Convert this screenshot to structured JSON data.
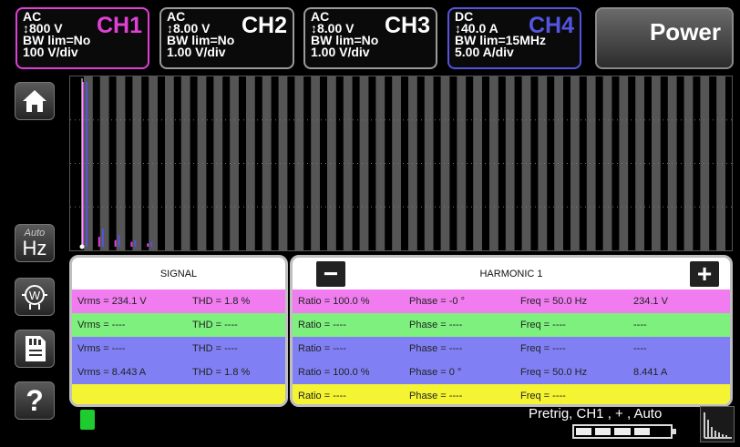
{
  "channels": [
    {
      "id": "ch1",
      "coupling": "AC",
      "range": "↕800 V",
      "bw": "BW lim=No",
      "scale": "100 V/div",
      "label": "CH1",
      "color": "#e040d8"
    },
    {
      "id": "ch2",
      "coupling": "AC",
      "range": "↕8.00 V",
      "bw": "BW lim=No",
      "scale": "1.00 V/div",
      "label": "CH2",
      "color": "#ffffff"
    },
    {
      "id": "ch3",
      "coupling": "AC",
      "range": "↕8.00 V",
      "bw": "BW lim=No",
      "scale": "1.00 V/div",
      "label": "CH3",
      "color": "#ffffff"
    },
    {
      "id": "ch4",
      "coupling": "DC",
      "range": "↕40.0 A",
      "bw": "BW lim=15MHz",
      "scale": "5.00 A/div",
      "label": "CH4",
      "color": "#5454e0"
    }
  ],
  "power_label": "Power",
  "sidebar": {
    "home_icon": "home-icon",
    "auto_label": "Auto",
    "hz_label": "Hz",
    "wattmeter_icon": "wattmeter-icon",
    "memory_icon": "memory-card-icon",
    "help_label": "?"
  },
  "spectrum": {
    "colors": {
      "stripe": "#555555",
      "ch1": "#e040d8",
      "ch4": "#5454e0"
    },
    "harmonics_ch1": [
      1.0,
      0.06,
      0.04,
      0.03,
      0.02
    ],
    "harmonics_ch4": [
      1.0,
      0.11,
      0.07,
      0.04,
      0.03
    ]
  },
  "signal_panel": {
    "title": "SIGNAL",
    "rows": [
      {
        "vrms": "Vrms = 234.1 V",
        "thd": "THD = 1.8 %",
        "color": "#f07cf0"
      },
      {
        "vrms": "Vrms = ----",
        "thd": "THD = ----",
        "color": "#7ef07e"
      },
      {
        "vrms": "Vrms = ----",
        "thd": "THD = ----",
        "color": "#8080f4"
      },
      {
        "vrms": "Vrms = 8.443 A",
        "thd": "THD = 1.8 %",
        "color": "#8080f4"
      },
      {
        "vrms": "",
        "thd": "",
        "color": "#f4f432"
      }
    ]
  },
  "harmonic_panel": {
    "title": "HARMONIC 1",
    "minus_label": "−",
    "plus_label": "+",
    "rows": [
      {
        "ratio": "Ratio = 100.0 %",
        "phase": "Phase = -0 °",
        "freq": "Freq = 50.0 Hz",
        "value": "234.1 V",
        "color": "#f07cf0"
      },
      {
        "ratio": "Ratio = ----",
        "phase": "Phase = ----",
        "freq": "Freq = ----",
        "value": "----",
        "color": "#7ef07e"
      },
      {
        "ratio": "Ratio = ----",
        "phase": "Phase = ----",
        "freq": "Freq = ----",
        "value": "----",
        "color": "#8080f4"
      },
      {
        "ratio": "Ratio = 100.0 %",
        "phase": "Phase = 0 °",
        "freq": "Freq = 50.0 Hz",
        "value": "8.441 A",
        "color": "#8080f4"
      },
      {
        "ratio": "Ratio = ----",
        "phase": "Phase = ----",
        "freq": "Freq = ----",
        "value": "",
        "color": "#f4f432"
      }
    ]
  },
  "status": {
    "trigger_text": "Pretrig, CH1 , + , Auto",
    "battery_level": 0.8,
    "sd_icon": "sd-card-icon",
    "spectrum_icon": "spectrum-icon"
  }
}
